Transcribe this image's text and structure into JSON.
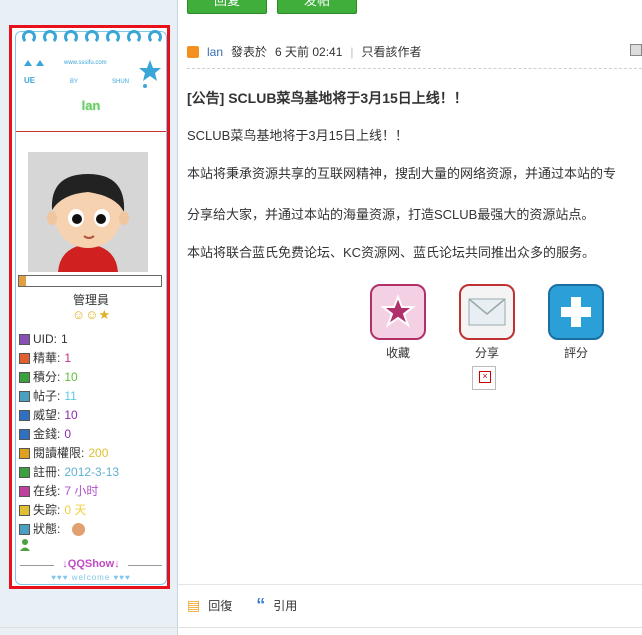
{
  "top_buttons": [
    "回复",
    "发帖"
  ],
  "profile": {
    "site_deco_text": "www.sssifu.com",
    "deco_letters": [
      "UE",
      "BY",
      "SHUN"
    ],
    "username": "lan",
    "progress_fraction": 0.05,
    "rank": "管理員",
    "stats": [
      {
        "label": "UID:",
        "value": "1",
        "icon_color": "#8a4fb5",
        "value_color": "#333333"
      },
      {
        "label": "精華:",
        "value": "1",
        "icon_color": "#e06030",
        "value_color": "#c0308a"
      },
      {
        "label": "積分:",
        "value": "10",
        "icon_color": "#3aa040",
        "value_color": "#5fbf3a"
      },
      {
        "label": "帖子:",
        "value": "11",
        "icon_color": "#4aa0c0",
        "value_color": "#5fc8e0"
      },
      {
        "label": "威望:",
        "value": "10",
        "icon_color": "#3070c0",
        "value_color": "#8a2bb0"
      },
      {
        "label": "金錢:",
        "value": "0",
        "icon_color": "#3070c0",
        "value_color": "#8a2bb0"
      },
      {
        "label": "閱讀權限:",
        "value": "200",
        "icon_color": "#e0a020",
        "value_color": "#e0c030"
      },
      {
        "label": "註冊:",
        "value": "2012-3-13",
        "icon_color": "#3aa040",
        "value_color": "#5fb0d0"
      },
      {
        "label": "在线:",
        "value": "7 小时",
        "icon_color": "#c040a0",
        "value_color": "#b050d0"
      },
      {
        "label": "失踪:",
        "value": "0 天",
        "icon_color": "#e0c030",
        "value_color": "#f0d040"
      },
      {
        "label": "狀態:",
        "value": "",
        "icon_color": "#4aa0c0",
        "value_color": "#333333"
      }
    ],
    "qqshow": "↓QQShow↓",
    "welcome": "♥♥♥ welcome ♥♥♥"
  },
  "post": {
    "author": "lan",
    "posted_label": "發表於",
    "time": "6 天前 02:41",
    "author_only": "只看該作者",
    "title": "[公告] SCLUB菜鸟基地将于3月15日上线！！",
    "paragraphs": [
      "SCLUB菜鸟基地将于3月15日上线！！",
      "本站将秉承资源共享的互联网精神，搜刮大量的网络资源，并通过本站的专",
      "分享给大家，并通过本站的海量资源，打造SCLUB最强大的资源站点。",
      "本站将联合蓝氏免费论坛、KC资源网、蓝氏论坛共同推出众多的服务。"
    ],
    "actions": [
      {
        "label": "收藏",
        "icon": "star-icon"
      },
      {
        "label": "分享",
        "icon": "envelope-icon"
      },
      {
        "label": "評分",
        "icon": "plus-icon"
      }
    ],
    "footer": {
      "reply": "回復",
      "quote": "引用"
    }
  }
}
